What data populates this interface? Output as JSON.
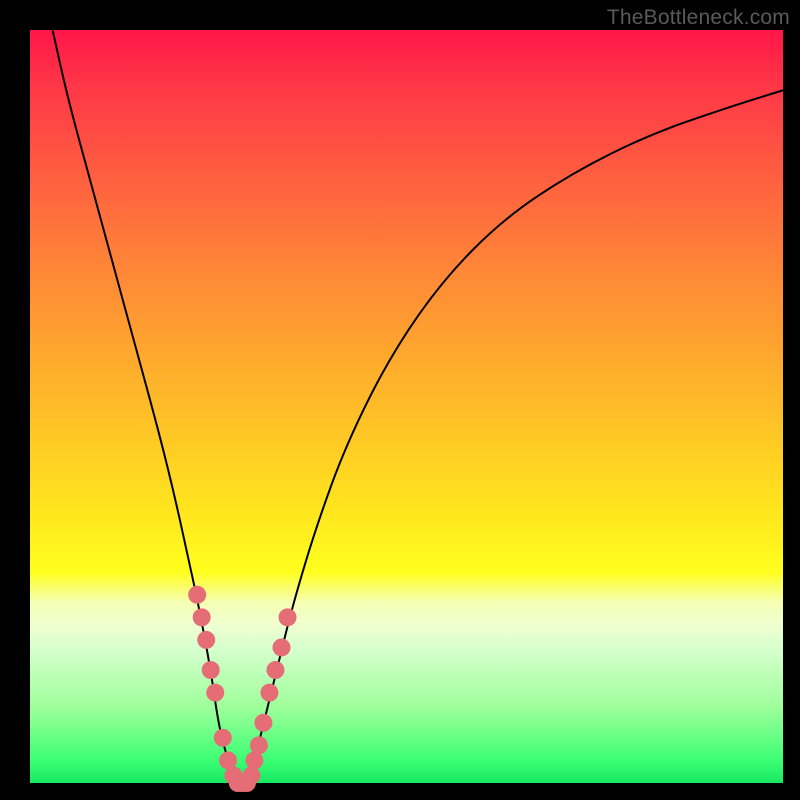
{
  "watermark": "TheBottleneck.com",
  "chart_data": {
    "type": "line",
    "title": "",
    "xlabel": "",
    "ylabel": "",
    "xlim": [
      0,
      100
    ],
    "ylim": [
      0,
      100
    ],
    "series": [
      {
        "name": "curve",
        "x": [
          3,
          5,
          8,
          11,
          14,
          17,
          19,
          21,
          22.5,
          24,
          25,
          26,
          27,
          27.8,
          28.5,
          29.8,
          31.3,
          33,
          35,
          38,
          42,
          48,
          55,
          63,
          72,
          82,
          92,
          100
        ],
        "values": [
          100,
          91,
          80,
          69,
          58,
          47,
          39,
          30,
          23,
          15,
          8,
          4,
          1,
          0,
          0,
          3,
          9,
          16,
          24,
          34,
          45,
          57,
          67,
          75,
          81,
          86,
          89.5,
          92
        ]
      }
    ],
    "annotations": {
      "dots_left": {
        "x": [
          22.2,
          22.8,
          23.4,
          24.0,
          24.6,
          25.6,
          26.3,
          27.0
        ],
        "y": [
          25,
          22,
          19,
          15,
          12,
          6,
          3,
          1
        ]
      },
      "dots_right": {
        "x": [
          29.4,
          29.8,
          30.4,
          31.0,
          31.8,
          32.6,
          33.4,
          34.2
        ],
        "y": [
          1,
          3,
          5,
          8,
          12,
          15,
          18,
          22
        ]
      },
      "dots_base": {
        "x": [
          27.6,
          28.2,
          28.8
        ],
        "y": [
          0,
          0,
          0
        ]
      }
    },
    "colors": {
      "curve": "#000000",
      "dots": "#e46d76",
      "gradient_top": "#ff1648",
      "gradient_bottom": "#17e961"
    }
  }
}
